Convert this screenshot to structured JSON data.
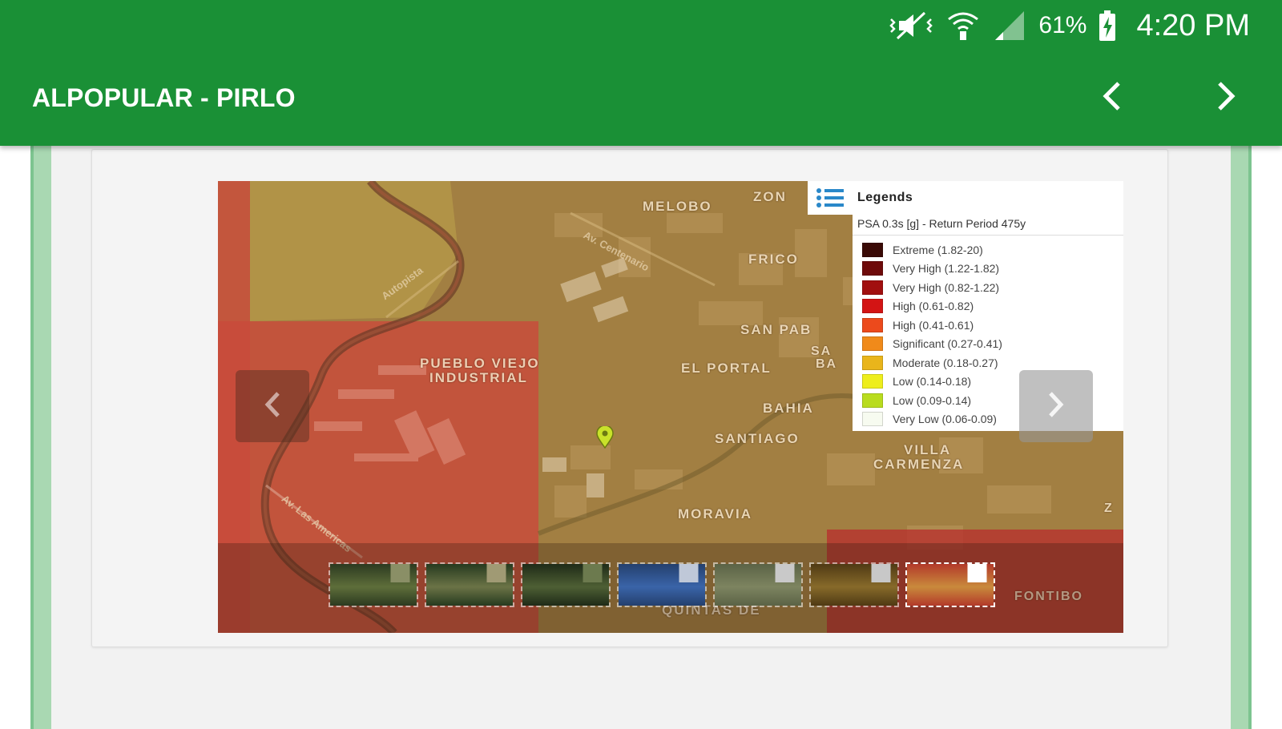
{
  "status_bar": {
    "battery_percent": "61%",
    "time": "4:20 PM",
    "icons": [
      "vibrate-muted-icon",
      "wifi-icon",
      "cellular-signal-icon",
      "battery-charging-icon"
    ]
  },
  "app_bar": {
    "title": "ALPOPULAR - PIRLO",
    "prev_icon": "chevron-left-icon",
    "next_icon": "chevron-right-icon",
    "color": "#1a9036"
  },
  "map": {
    "places": [
      "MELOBO",
      "ZON",
      "FRICO",
      "SAN PAB",
      "SA",
      "BA",
      "PUEBLO VIEJO",
      "INDUSTRIAL",
      "EL PORTAL",
      "BAHIA",
      "SANTIAGO",
      "VILLA",
      "CARMENZA",
      "MORAVIA",
      "QUINTAS DE",
      "FONTIBO",
      "Z"
    ],
    "streets": [
      "Av. Centenario",
      "Autopista",
      "Av. Las Americas"
    ]
  },
  "legend": {
    "title": "Legends",
    "subtitle": "PSA 0.3s [g] - Return Period 475y",
    "items": [
      {
        "label": "Extreme (1.82-20)",
        "color": "#3a0a06"
      },
      {
        "label": "Very High (1.22-1.82)",
        "color": "#6e0a0a"
      },
      {
        "label": "Very High (0.82-1.22)",
        "color": "#a10f0f"
      },
      {
        "label": "High (0.61-0.82)",
        "color": "#d31414"
      },
      {
        "label": "High (0.41-0.61)",
        "color": "#ec4a1c"
      },
      {
        "label": "Significant (0.27-0.41)",
        "color": "#f08a1a"
      },
      {
        "label": "Moderate (0.18-0.27)",
        "color": "#e9b51b"
      },
      {
        "label": "Low (0.14-0.18)",
        "color": "#eeee1c"
      },
      {
        "label": "Low (0.09-0.14)",
        "color": "#b9dc1e"
      },
      {
        "label": "Very Low (0.06-0.09)",
        "color": "#f7fbf0"
      }
    ]
  },
  "carousel": {
    "prev_icon": "chevron-left-icon",
    "next_icon": "chevron-right-icon",
    "thumbnails": [
      {
        "name": "aerial-field-1",
        "colors": [
          "#2c3a20",
          "#5e6e3a",
          "#8a8f66"
        ]
      },
      {
        "name": "aerial-field-2",
        "colors": [
          "#263a1f",
          "#6b7346",
          "#a09a74"
        ]
      },
      {
        "name": "aerial-field-3",
        "colors": [
          "#1f2b18",
          "#4e5f34",
          "#6c7a4e"
        ]
      },
      {
        "name": "map-blue",
        "colors": [
          "#24406e",
          "#3a64a8",
          "#bfc8d8"
        ]
      },
      {
        "name": "map-gray",
        "colors": [
          "#5b6346",
          "#7d8460",
          "#c9c9c9"
        ]
      },
      {
        "name": "map-brown",
        "colors": [
          "#4f3a14",
          "#876a2a",
          "#c8c8c8"
        ]
      },
      {
        "name": "map-hazard",
        "colors": [
          "#b33a2a",
          "#c98a3c",
          "#ffffff"
        ]
      }
    ]
  }
}
